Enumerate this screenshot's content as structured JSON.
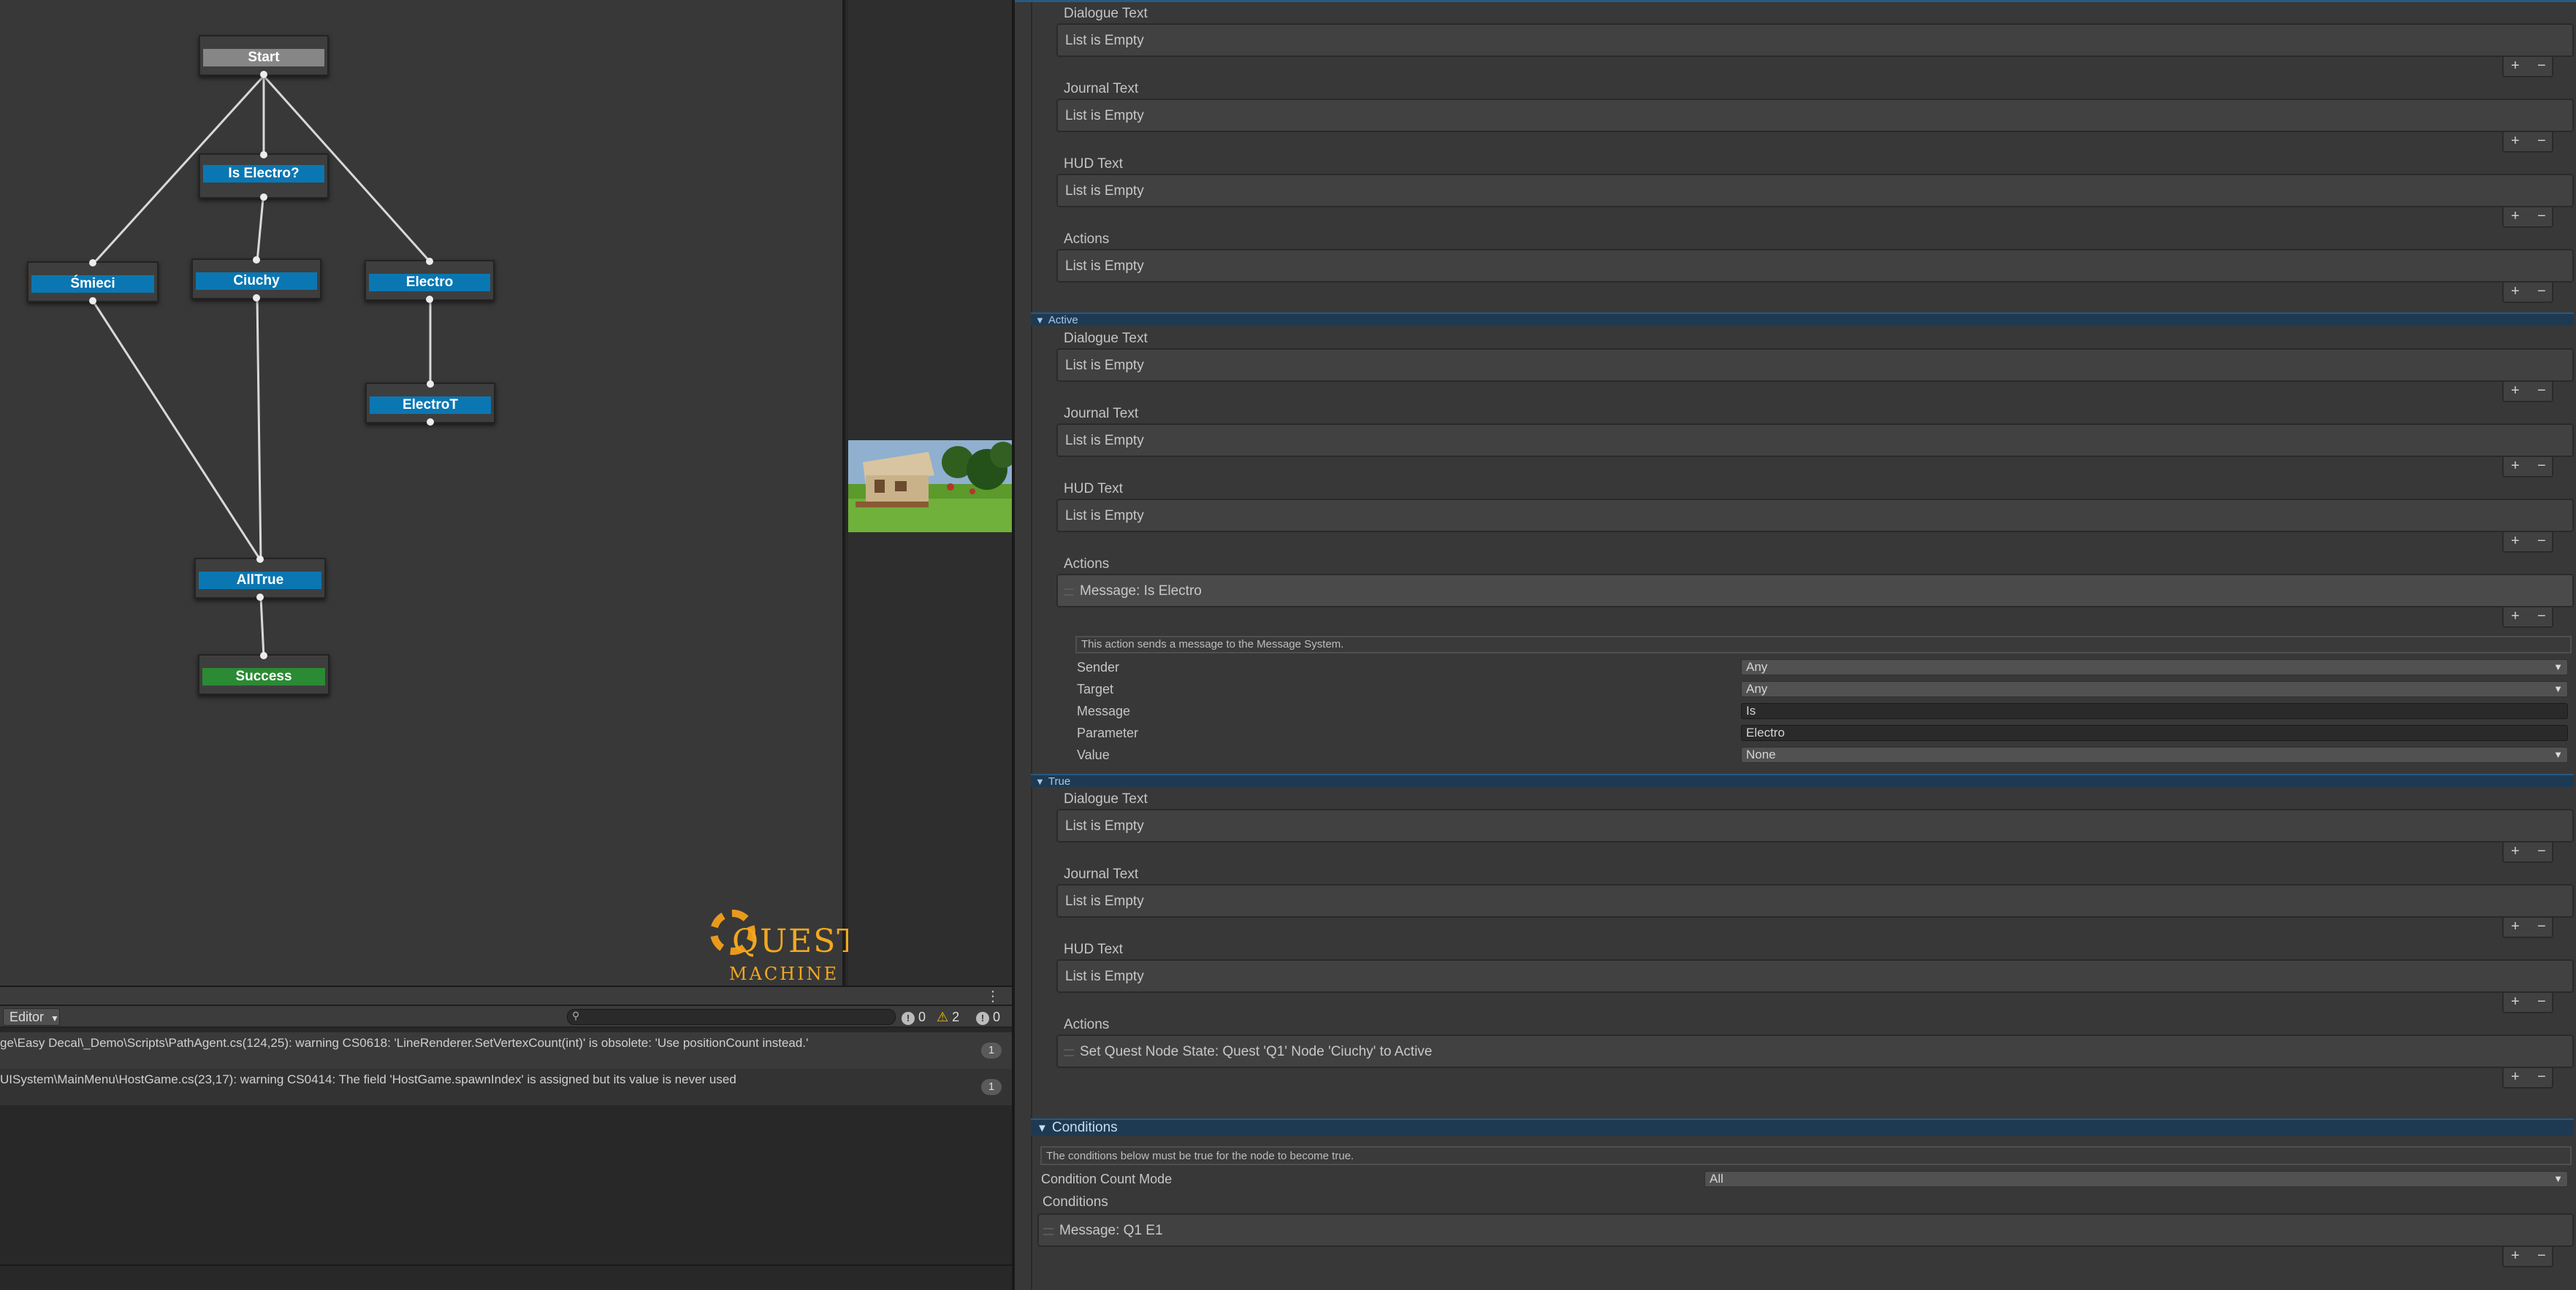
{
  "graph": {
    "nodes": {
      "start": "Start",
      "is_electro": "Is Electro?",
      "smieci": "Śmieci",
      "ciuchy": "Ciuchy",
      "electro": "Electro",
      "electro_t": "ElectroT",
      "all_true": "AllTrue",
      "success": "Success"
    },
    "logo": {
      "line1": "QUEST",
      "line2": "MACHINE"
    }
  },
  "console": {
    "mode_dropdown": "Editor",
    "errors_count": "0",
    "warnings_count": "2",
    "messages_count": "0",
    "rows": [
      {
        "text": "ge\\Easy Decal\\_Demo\\Scripts\\PathAgent.cs(124,25): warning CS0618: 'LineRenderer.SetVertexCount(int)' is obsolete: 'Use positionCount instead.'",
        "count": "1"
      },
      {
        "text": "UISystem\\MainMenu\\HostGame.cs(23,17): warning CS0414: The field 'HostGame.spawnIndex' is assigned but its value is never used",
        "count": "1"
      }
    ]
  },
  "inspector": {
    "list_empty": "List is Empty",
    "labels": {
      "dialogue_text": "Dialogue Text",
      "journal_text": "Journal Text",
      "hud_text": "HUD Text",
      "actions": "Actions"
    },
    "plus": "+",
    "minus": "−",
    "sections": {
      "active": "Active",
      "true": "True"
    },
    "active_action": {
      "item": "Message: Is Electro",
      "hint": "This action sends a message to the Message System.",
      "sender_label": "Sender",
      "sender_value": "Any",
      "target_label": "Target",
      "target_value": "Any",
      "message_label": "Message",
      "message_value": "Is",
      "parameter_label": "Parameter",
      "parameter_value": "Electro",
      "value_label": "Value",
      "value_value": "None"
    },
    "true_action": {
      "item": "Set Quest Node State: Quest 'Q1' Node 'Ciuchy' to Active"
    },
    "conditions": {
      "header": "Conditions",
      "hint": "The conditions below must be true for the node to become true.",
      "count_mode_label": "Condition Count Mode",
      "count_mode_value": "All",
      "list_label": "Conditions",
      "item": "Message: Q1 E1"
    }
  }
}
